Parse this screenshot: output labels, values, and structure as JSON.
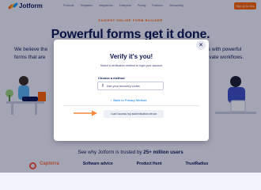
{
  "header": {
    "logo_text": "Jotform",
    "nav": [
      "Products",
      "Templates",
      "Integrations",
      "Enterprise",
      "Pricing",
      "Features",
      "Onboarding",
      "Pricing"
    ],
    "signup_label": "Sign up for free",
    "accent": "#ff6100"
  },
  "hero": {
    "eyebrow": "EASIEST ONLINE FORM BUILDER",
    "title": "Powerful forms get it done.",
    "left_text": "We believe the",
    "left_text_2": "forms that are",
    "right_text": "s with powerful",
    "right_text_2": "ivate workflows."
  },
  "trust": {
    "prefix": "See why Jotform is trusted by ",
    "highlight": "25+ million users",
    "brands": [
      "Capterra",
      "Software advice",
      "Product Hunt",
      "TrustRadius"
    ]
  },
  "modal": {
    "title": "Verify it's you!",
    "subtitle": "Select a verification method to login your account",
    "method_label": "Choose a method",
    "method_option": "Use your recovery codes",
    "method_icon": "key-icon",
    "back_link": "Back to Privacy Method",
    "cant_access": "I can't access my authentication device",
    "close_icon": "close-icon",
    "arrow_color": "#f5883c"
  }
}
